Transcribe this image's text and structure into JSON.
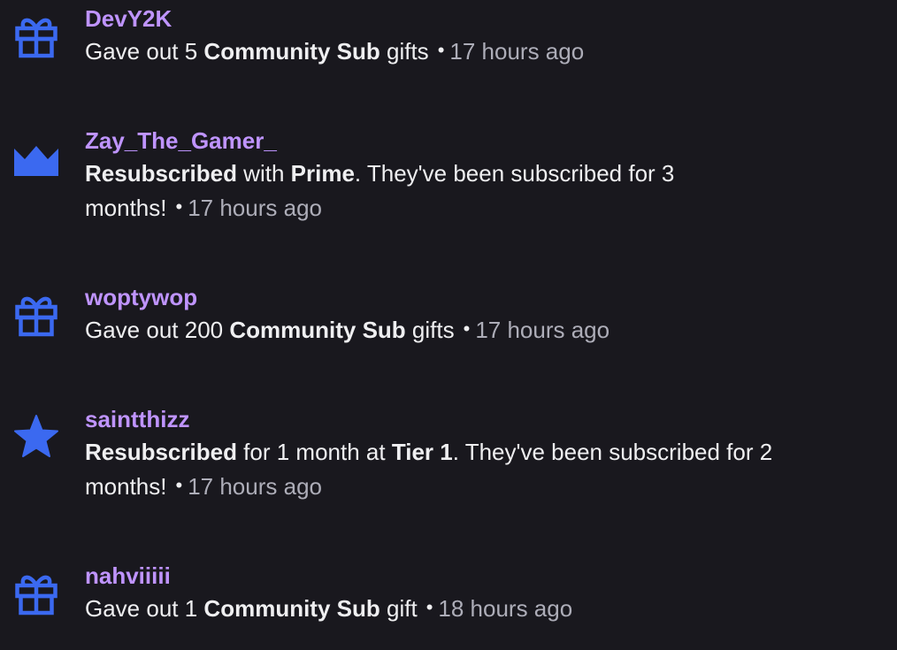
{
  "accent_color": "#bf94ff",
  "icon_color": "#3b69f0",
  "events": [
    {
      "icon": "gift-icon",
      "username": "DevY2K",
      "line_prefix": "Gave out 5 ",
      "bold_1": "Community Sub",
      "line_middle": " gifts",
      "bullet": "•",
      "time": "17 hours ago"
    },
    {
      "icon": "crown-icon",
      "username": "Zay_The_Gamer_",
      "bold_1": "Resubscribed",
      "line_middle": " with ",
      "bold_2": "Prime",
      "line_suffix": ". They've been subscribed for 3",
      "line_2": "months!",
      "bullet": "•",
      "time": "17 hours ago"
    },
    {
      "icon": "gift-icon",
      "username": "woptywop",
      "line_prefix": "Gave out 200 ",
      "bold_1": "Community Sub",
      "line_middle": " gifts",
      "bullet": "•",
      "time": "17 hours ago"
    },
    {
      "icon": "star-icon",
      "username": "saintthizz",
      "bold_1": "Resubscribed",
      "line_middle": " for 1 month at ",
      "bold_2": "Tier 1",
      "line_suffix": ". They've been subscribed for 2",
      "line_2": "months!",
      "bullet": "•",
      "time": "17 hours ago"
    },
    {
      "icon": "gift-icon",
      "username": "nahviiiii",
      "line_prefix": "Gave out 1 ",
      "bold_1": "Community Sub",
      "line_middle": " gift",
      "bullet": "•",
      "time": "18 hours ago"
    }
  ]
}
